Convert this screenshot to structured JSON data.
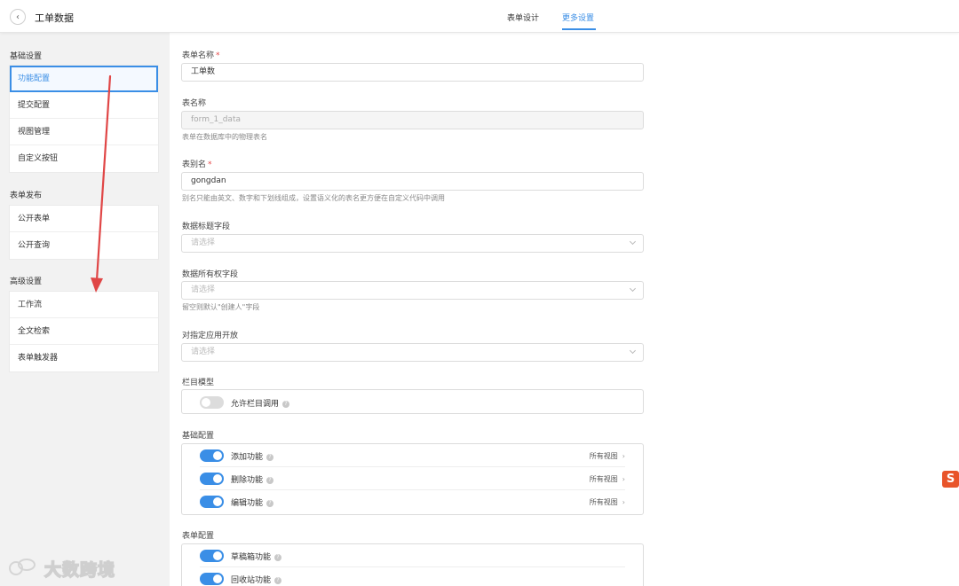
{
  "header": {
    "title": "工单数据",
    "back_icon": "‹",
    "tabs": [
      {
        "label": "表单设计",
        "active": false
      },
      {
        "label": "更多设置",
        "active": true
      }
    ]
  },
  "sidebar": {
    "groups": [
      {
        "title": "基础设置",
        "items": [
          "功能配置",
          "提交配置",
          "视图管理",
          "自定义按钮"
        ],
        "active_index": 0
      },
      {
        "title": "表单发布",
        "items": [
          "公开表单",
          "公开查询"
        ]
      },
      {
        "title": "高级设置",
        "items": [
          "工作流",
          "全文检索",
          "表单触发器"
        ]
      }
    ]
  },
  "form": {
    "form_name": {
      "label": "表单名称",
      "required": "*",
      "value": "工单数"
    },
    "table_name": {
      "label": "表名称",
      "value": "form_1_data",
      "hint": "表单在数据库中的物理表名"
    },
    "alias": {
      "label": "表别名",
      "required": "*",
      "value": "gongdan",
      "hint": "别名只能由英文、数字和下划线组成，设置语义化的表名更方便在自定义代码中调用"
    },
    "title_field": {
      "label": "数据标题字段",
      "placeholder": "请选择"
    },
    "owner_field": {
      "label": "数据所有权字段",
      "placeholder": "请选择",
      "hint": "留空则默认\"创建人\"字段"
    },
    "open_to_app": {
      "label": "对指定应用开放",
      "placeholder": "请选择"
    },
    "column_model": {
      "label": "栏目模型",
      "toggle_label": "允许栏目调用",
      "enabled": false
    },
    "basic_config": {
      "label": "基础配置",
      "rows": [
        {
          "label": "添加功能",
          "enabled": true,
          "right": "所有视图"
        },
        {
          "label": "删除功能",
          "enabled": true,
          "right": "所有视图"
        },
        {
          "label": "编辑功能",
          "enabled": true,
          "right": "所有视图"
        }
      ]
    },
    "form_config": {
      "label": "表单配置",
      "rows": [
        {
          "label": "草稿箱功能",
          "enabled": true
        },
        {
          "label": "回收站功能",
          "enabled": true
        }
      ]
    }
  },
  "help_icon": "?",
  "chevron_right": "›",
  "ime_icon": "S",
  "watermark": "大数跨境",
  "colors": {
    "accent": "#3a8ee6",
    "annotation_arrow": "#e04646",
    "sidebar_bg": "#f2f2f2"
  }
}
